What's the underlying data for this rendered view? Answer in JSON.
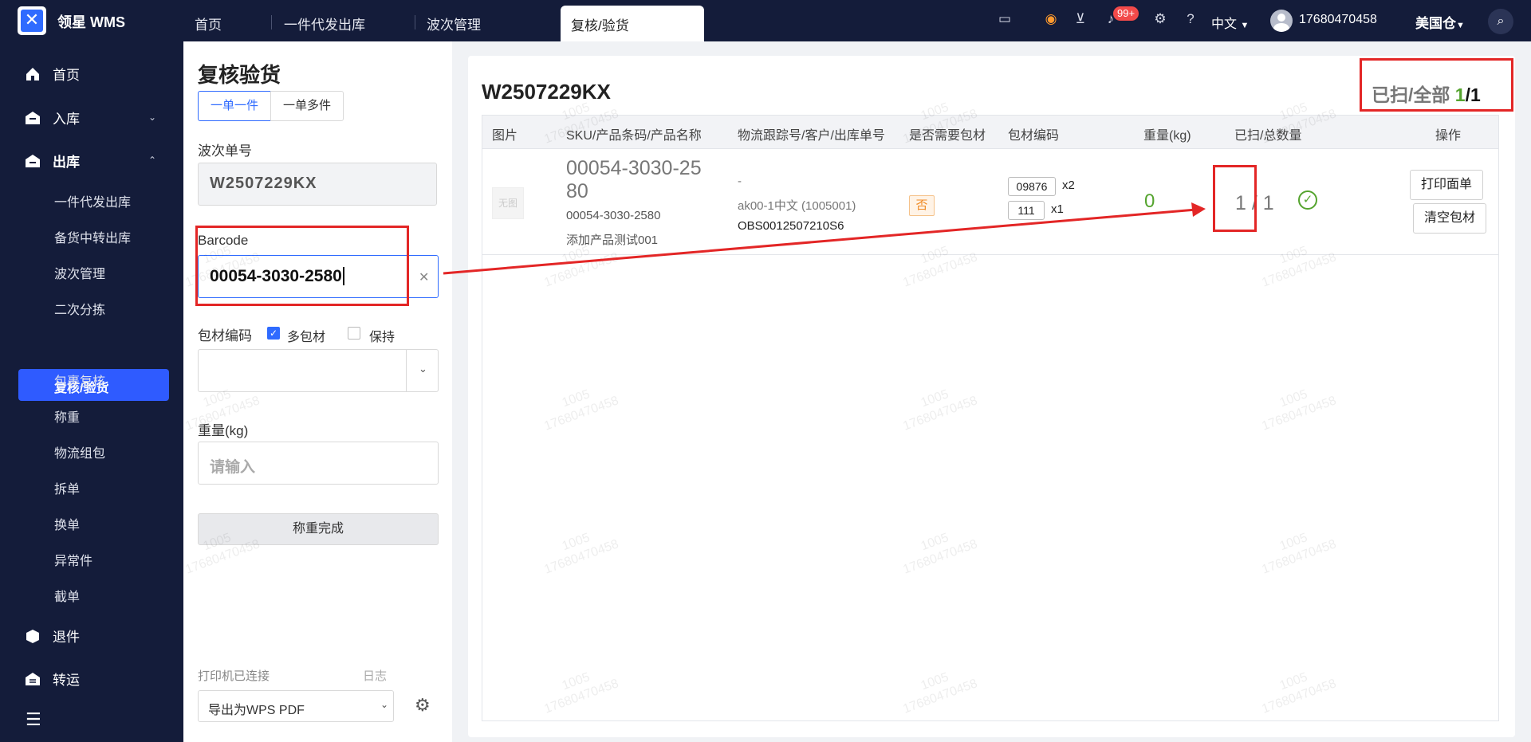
{
  "app": {
    "name": "领星 WMS"
  },
  "tabs": [
    {
      "label": "首页"
    },
    {
      "label": "一件代发出库"
    },
    {
      "label": "波次管理"
    },
    {
      "label": "复核/验货"
    }
  ],
  "header": {
    "notification_badge": "99+",
    "language": "中文",
    "user_phone": "17680470458",
    "warehouse": "美国仓"
  },
  "sidebar": {
    "home": "首页",
    "inbound": "入库",
    "outbound": "出库",
    "outbound_items": [
      "一件代发出库",
      "备货中转出库",
      "波次管理",
      "二次分拣",
      "复核/验货",
      "包裹复核",
      "称重",
      "物流组包",
      "拆单",
      "换单",
      "异常件",
      "截单"
    ],
    "returns": "退件",
    "transfer": "转运"
  },
  "form": {
    "title": "复核验货",
    "mode_single": "一单一件",
    "mode_multi": "一单多件",
    "wave_label": "波次单号",
    "wave_value": "W2507229KX",
    "barcode_label": "Barcode",
    "barcode_value": "00054-3030-2580",
    "pkg_label": "包材编码",
    "multi_pkg_label": "多包材",
    "keep_label": "保持",
    "weight_label": "重量(kg)",
    "weight_placeholder": "请输入",
    "weigh_button": "称重完成",
    "printer_status": "打印机已连接",
    "log_link": "日志",
    "printer_value": "导出为WPS PDF"
  },
  "main": {
    "wave_no": "W2507229KX",
    "scan_label": "已扫/全部",
    "scan_done": "1",
    "scan_total": "/1",
    "columns": [
      "图片",
      "SKU/产品条码/产品名称",
      "物流跟踪号/客户/出库单号",
      "是否需要包材",
      "包材编码",
      "重量(kg)",
      "已扫/总数量",
      "操作"
    ],
    "row": {
      "image_placeholder": "无图",
      "sku_line1": "00054-3030-25",
      "sku_line2": "80",
      "barcode": "00054-3030-2580",
      "product_name": "添加产品测试001",
      "tracking": "-",
      "customer": "ak00-1中文 (1005001)",
      "outbound_no": "OBS0012507210S6",
      "need_pkg": "否",
      "pkg1_code": "09876",
      "pkg1_qty": "x2",
      "pkg2_code": "111",
      "pkg2_qty": "x1",
      "weight": "0",
      "scanned": "1 / 1",
      "print_button": "打印面单",
      "clear_button": "清空包材"
    }
  },
  "watermark": {
    "line1": "1005",
    "line2": "17680470458"
  },
  "colors": {
    "topbar": "#141c3a",
    "accent": "#2f6bff",
    "success": "#55a42f",
    "annotation": "#e32626"
  }
}
